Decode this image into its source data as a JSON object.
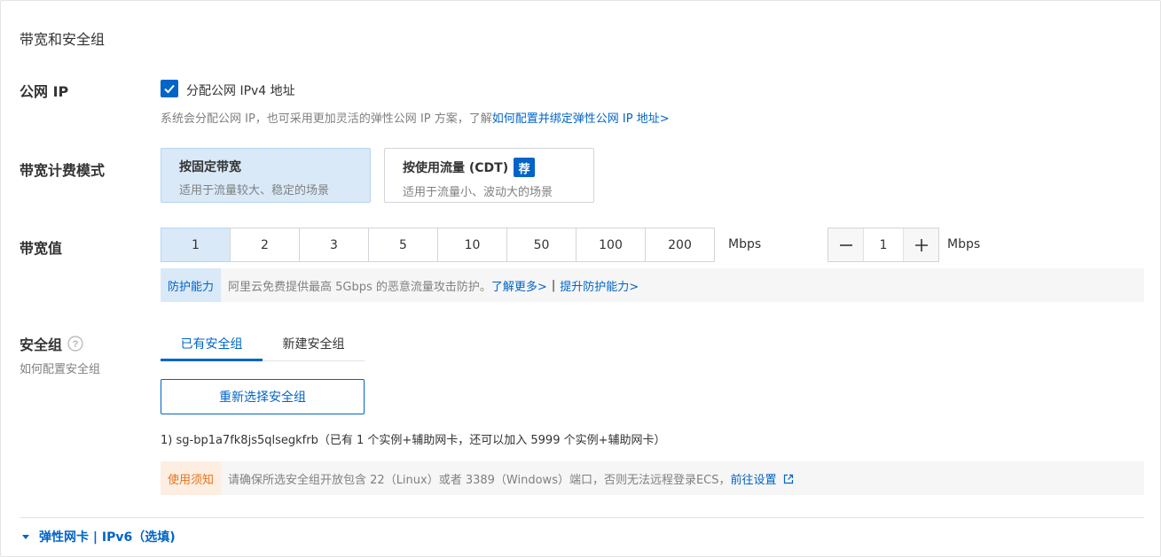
{
  "section_title": "带宽和安全组",
  "public_ip": {
    "label": "公网 IP",
    "checkbox_label": "分配公网 IPv4 地址",
    "checked": true,
    "hint": "系统会分配公网 IP，也可采用更加灵活的弹性公网 IP 方案，了解",
    "hint_link": "如何配置并绑定弹性公网 IP 地址>"
  },
  "billing_mode": {
    "label": "带宽计费模式",
    "options": [
      {
        "title": "按固定带宽",
        "desc": "适用于流量较大、稳定的场景",
        "badge": ""
      },
      {
        "title": "按使用流量 (CDT)",
        "desc": "适用于流量小、波动大的场景",
        "badge": "荐"
      }
    ],
    "selected": 0
  },
  "bandwidth": {
    "label": "带宽值",
    "options": [
      "1",
      "2",
      "3",
      "5",
      "10",
      "50",
      "100",
      "200"
    ],
    "selected_value": "1",
    "unit": "Mbps",
    "stepper_value": "1",
    "stepper_unit": "Mbps"
  },
  "protection": {
    "tag": "防护能力",
    "text": "阿里云免费提供最高 5Gbps 的恶意流量攻击防护。",
    "link1": "了解更多>",
    "separator": "|",
    "link2": "提升防护能力>"
  },
  "security_group": {
    "label": "安全组",
    "help_link": "如何配置安全组",
    "tabs": [
      "已有安全组",
      "新建安全组"
    ],
    "active_tab": 0,
    "reselect_button": "重新选择安全组",
    "selected_item": "1) sg-bp1a7fk8js5qlsegkfrb（已有 1 个实例+辅助网卡，还可以加入 5999 个实例+辅助网卡）"
  },
  "usage_notice": {
    "tag": "使用须知",
    "text": "请确保所选安全组开放包含 22（Linux）或者 3389（Windows）端口，否则无法远程登录ECS，",
    "link": "前往设置"
  },
  "expander": {
    "label": "弹性网卡 | IPv6（选填)"
  },
  "colors": {
    "accent": "#0064c8",
    "selected_bg": "#d9e9f8",
    "notice_bg": "#f6f6f6",
    "usage_tag_color": "#e8731c",
    "usage_tag_bg": "#fdeee1"
  }
}
